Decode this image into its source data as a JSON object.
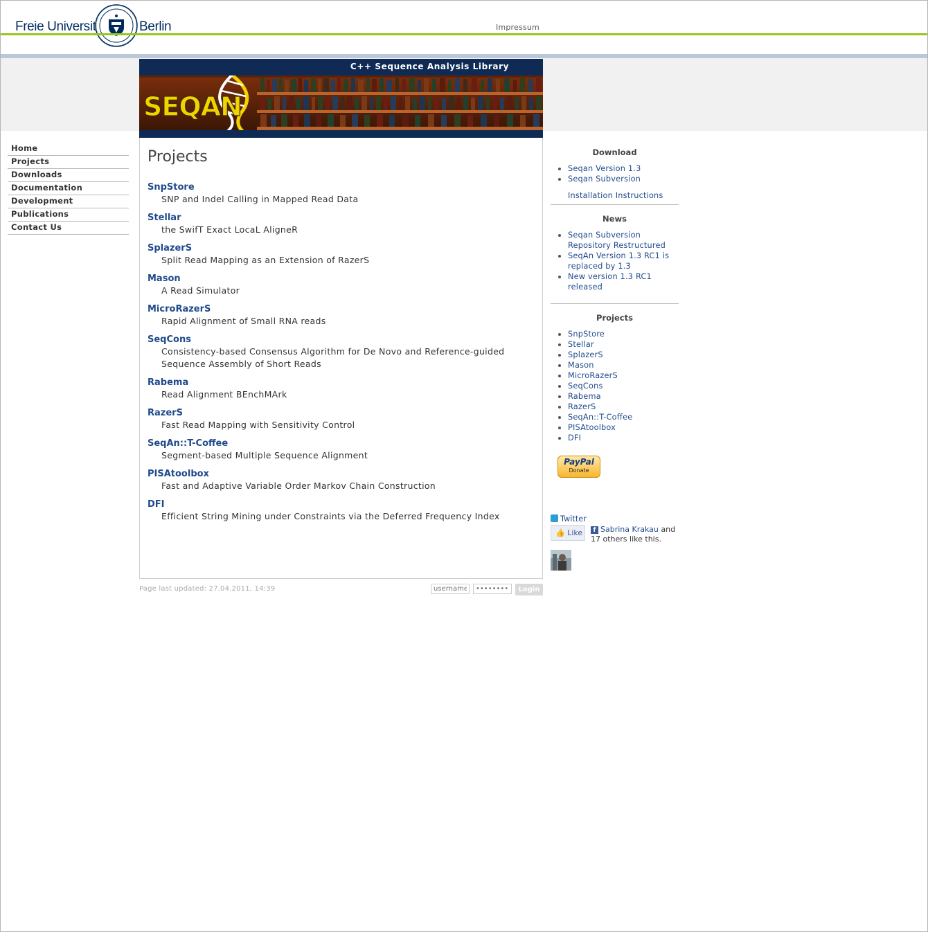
{
  "header": {
    "university_left": "Freie Universität",
    "university_right": "Berlin",
    "impressum": "Impressum"
  },
  "banner": {
    "tagline": "C++ Sequence Analysis Library",
    "logo_text": "SEQAN"
  },
  "nav": {
    "items": [
      "Home",
      "Projects",
      "Downloads",
      "Documentation",
      "Development",
      "Publications",
      "Contact Us"
    ]
  },
  "main": {
    "title": "Projects",
    "projects": [
      {
        "name": "SnpStore",
        "desc": "SNP and Indel Calling in Mapped Read Data"
      },
      {
        "name": "Stellar",
        "desc": "the SwifT Exact LocaL AligneR"
      },
      {
        "name": "SplazerS",
        "desc": "Split Read Mapping as an Extension of RazerS"
      },
      {
        "name": "Mason",
        "desc": "A Read Simulator"
      },
      {
        "name": "MicroRazerS",
        "desc": "Rapid Alignment of Small RNA reads"
      },
      {
        "name": "SeqCons",
        "desc": "Consistency-based Consensus Algorithm for De Novo and Reference-guided Sequence Assembly of Short Reads"
      },
      {
        "name": "Rabema",
        "desc": "Read Alignment BEnchMArk"
      },
      {
        "name": "RazerS",
        "desc": "Fast Read Mapping with Sensitivity Control"
      },
      {
        "name": "SeqAn::T-Coffee",
        "desc": "Segment-based Multiple Sequence Alignment"
      },
      {
        "name": "PISAtoolbox",
        "desc": "Fast and Adaptive Variable Order Markov Chain Construction"
      },
      {
        "name": "DFI",
        "desc": "Efficient String Mining under Constraints via the Deferred Frequency Index"
      }
    ]
  },
  "footer": {
    "updated": "Page last updated: 27.04.2011, 14:39",
    "username_placeholder": "username",
    "password_placeholder": "••••••••",
    "login_label": "Login"
  },
  "sidebar": {
    "download": {
      "title": "Download",
      "items": [
        "Seqan Version 1.3",
        "Seqan Subversion"
      ],
      "extra": "Installation Instructions"
    },
    "news": {
      "title": "News",
      "items": [
        "Seqan Subversion Repository Restructured",
        "SeqAn Version 1.3 RC1 is replaced by 1.3",
        "New version 1.3 RC1 released"
      ]
    },
    "projects": {
      "title": "Projects",
      "items": [
        "SnpStore",
        "Stellar",
        "SplazerS",
        "Mason",
        "MicroRazerS",
        "SeqCons",
        "Rabema",
        "RazerS",
        "SeqAn::T-Coffee",
        "PISAtoolbox",
        "DFI"
      ]
    },
    "paypal": {
      "logo": "PayPal",
      "label": "Donate"
    },
    "twitter": "Twitter",
    "facebook": {
      "like": "Like",
      "user": "Sabrina Krakau",
      "and": "and",
      "others": "17 others like this."
    }
  },
  "colors": {
    "link": "#1f4a8c",
    "green_bar": "#99c61b",
    "blue_bar": "#bac8da",
    "banner_bg": "#0f2b55"
  }
}
